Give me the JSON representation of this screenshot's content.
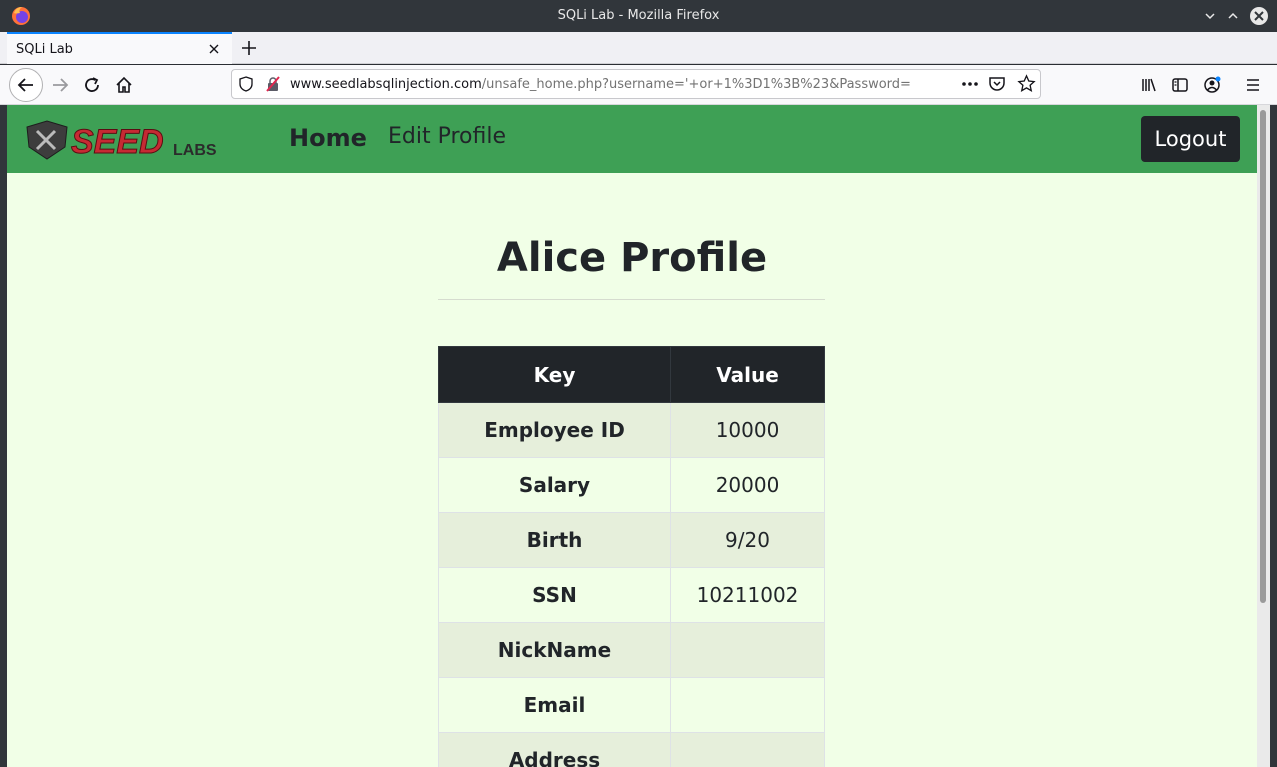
{
  "window": {
    "title": "SQLi Lab - Mozilla Firefox"
  },
  "tab": {
    "label": "SQLi Lab"
  },
  "url": {
    "host": "www.seedlabsqlinjection.com",
    "path": "/unsafe_home.php?username='+or+1%3D1%3B%23&Password="
  },
  "site": {
    "nav_home": "Home",
    "nav_edit": "Edit Profile",
    "logout": "Logout",
    "brand_colors": {
      "nav": "#3ea055",
      "page_bg": "#f1ffe7",
      "dark": "#212529"
    }
  },
  "profile": {
    "title": "Alice Profile",
    "headers": {
      "key": "Key",
      "value": "Value"
    },
    "rows": [
      {
        "key": "Employee ID",
        "value": "10000"
      },
      {
        "key": "Salary",
        "value": "20000"
      },
      {
        "key": "Birth",
        "value": "9/20"
      },
      {
        "key": "SSN",
        "value": "10211002"
      },
      {
        "key": "NickName",
        "value": ""
      },
      {
        "key": "Email",
        "value": ""
      },
      {
        "key": "Address",
        "value": ""
      }
    ]
  }
}
